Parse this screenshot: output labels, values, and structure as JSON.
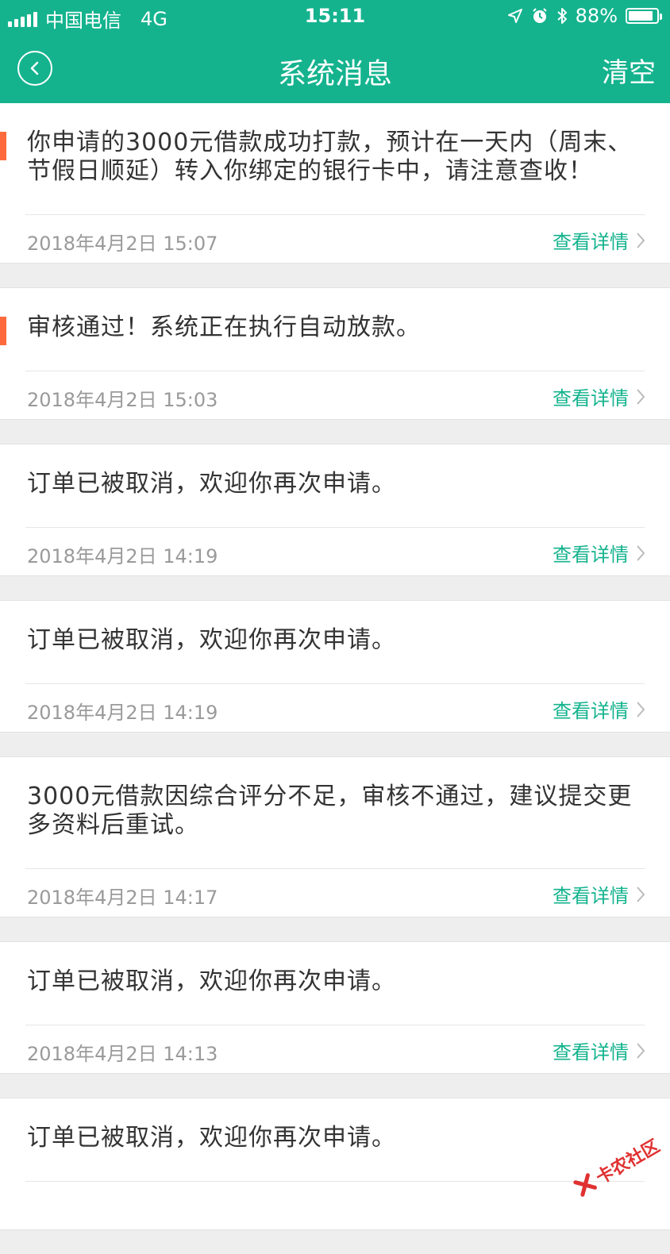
{
  "status_bar": {
    "carrier": "中国电信",
    "network": "4G",
    "time": "15:11",
    "battery_text": "88%",
    "battery_level": 0.88
  },
  "nav": {
    "title": "系统消息",
    "clear_label": "清空"
  },
  "messages": [
    {
      "text": "你申请的3000元借款成功打款，预计在一天内（周末、节假日顺延）转入你绑定的银行卡中，请注意查收！",
      "time": "2018年4月2日 15:07",
      "detail_label": "查看详情",
      "unread": true
    },
    {
      "text": "审核通过！系统正在执行自动放款。",
      "time": "2018年4月2日 15:03",
      "detail_label": "查看详情",
      "unread": true
    },
    {
      "text": "订单已被取消，欢迎你再次申请。",
      "time": "2018年4月2日 14:19",
      "detail_label": "查看详情",
      "unread": false
    },
    {
      "text": "订单已被取消，欢迎你再次申请。",
      "time": "2018年4月2日 14:19",
      "detail_label": "查看详情",
      "unread": false
    },
    {
      "text": "3000元借款因综合评分不足，审核不通过，建议提交更多资料后重试。",
      "time": "2018年4月2日 14:17",
      "detail_label": "查看详情",
      "unread": false
    },
    {
      "text": "订单已被取消，欢迎你再次申请。",
      "time": "2018年4月2日 14:13",
      "detail_label": "查看详情",
      "unread": false
    },
    {
      "text": "订单已被取消，欢迎你再次申请。",
      "time": "",
      "detail_label": "",
      "unread": false
    }
  ],
  "watermark": {
    "text": "卡农社区"
  },
  "colors": {
    "brand_green": "#14b38e",
    "unread_orange": "#ff6a3d",
    "watermark_red": "#e03131"
  }
}
